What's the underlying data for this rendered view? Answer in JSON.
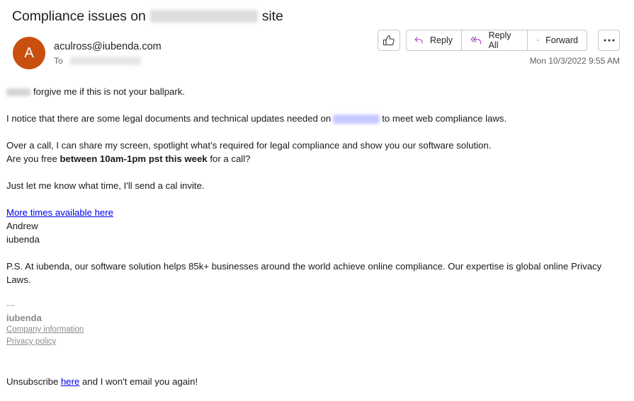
{
  "email": {
    "subject_prefix": "Compliance issues on",
    "subject_suffix": "site",
    "avatar_initial": "A",
    "sender": "aculross@iubenda.com",
    "to_label": "To",
    "timestamp": "Mon 10/3/2022 9:55 AM"
  },
  "actions": {
    "like_icon": "thumbs-up-icon",
    "reply": "Reply",
    "reply_all": "Reply All",
    "forward": "Forward",
    "more_icon": "more-horizontal-icon"
  },
  "body": {
    "greeting_rest": "forgive me if this is not your ballpark.",
    "p2_before": "I notice that there are some legal documents and technical updates needed on",
    "p2_after": "to meet web compliance laws.",
    "p3_line1": "Over a call, I can share my screen, spotlight what’s required for legal compliance and show you our software solution.",
    "p3_line2_before": "Are you free ",
    "p3_line2_bold": "between 10am-1pm pst this week",
    "p3_line2_after": " for a call?",
    "p4": "Just let me know what time, I'll send a cal invite.",
    "more_times_link": "More times available here",
    "sign_name": "Andrew",
    "sign_company": "iubenda",
    "ps": "P.S. At iubenda, our software solution helps 85k+ businesses around the world achieve online compliance. Our expertise is global online Privacy Laws.",
    "sig_dashes": "---",
    "sig_brand": "iubenda",
    "sig_company_info": "Company information",
    "sig_privacy": "Privacy policy",
    "unsub_before": "Unsubscribe ",
    "unsub_link": "here",
    "unsub_after": " and I won't email you again!"
  },
  "colors": {
    "avatar": "#c94f0f",
    "reply_icon": "#a33fbf",
    "forward_icon": "#0f6cbd",
    "link": "#0000ee"
  }
}
